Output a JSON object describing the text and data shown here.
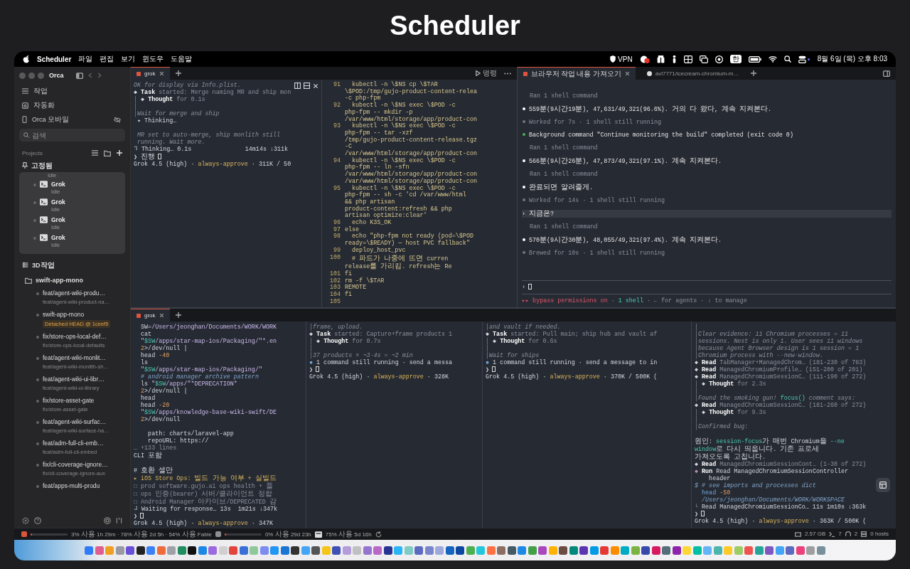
{
  "page_title": "Scheduler",
  "menu_bar": {
    "app_name": "Scheduler",
    "menus": [
      "파일",
      "편집",
      "보기",
      "윈도우",
      "도움말"
    ],
    "vpn_label": "VPN",
    "input_method": "한",
    "clock": "8월 6일 (목) 오후 8:03"
  },
  "sidebar": {
    "app_title": "Orca",
    "nav": [
      {
        "label": "작업",
        "kind": "tasks"
      },
      {
        "label": "자동화",
        "kind": "automation"
      },
      {
        "label": "Orca 모바일",
        "kind": "mobile"
      }
    ],
    "search": {
      "placeholder": "검색"
    },
    "projects_label": "Projects",
    "pinned": {
      "label": "고정됨",
      "clipped_status": "Idle",
      "sessions": [
        {
          "name": "Grok",
          "status": "Idle"
        },
        {
          "name": "Grok",
          "status": "Idle"
        },
        {
          "name": "Grok",
          "status": "Idle"
        },
        {
          "name": "Grok",
          "status": "Idle"
        }
      ]
    },
    "workspace_label": "3D작업",
    "repo": {
      "name": "swift-app-mono",
      "worktrees": [
        {
          "title": "feat/agent-wiki-produ…",
          "subtitle": "feat/agent-wiki-product-na…"
        },
        {
          "title": "swift-app-mono",
          "badge": "Detached HEAD @ 1ceef5"
        },
        {
          "title": "fix/store-ops-local-def…",
          "subtitle": "fix/store-ops-local-defaults"
        },
        {
          "title": "feat/agent-wiki-monlit…",
          "subtitle": "feat/agent-wiki-monlith-sh…"
        },
        {
          "title": "feat/agent-wiki-ui-libr…",
          "subtitle": "feat/agent-wiki-ui-library"
        },
        {
          "title": "fix/store-asset-gate",
          "subtitle": "fix/store-asset-gate"
        },
        {
          "title": "feat/agent-wiki-surfac…",
          "subtitle": "feat/agent-wiki-surface-ha…"
        },
        {
          "title": "feat/adm-full-cli-emb…",
          "subtitle": "feat/adm-full-cli-embed"
        },
        {
          "title": "fix/cli-coverage-ignore…",
          "subtitle": "fix/cli-coverage-ignore-aux"
        },
        {
          "title": "feat/apps-multi-produ"
        }
      ]
    }
  },
  "top_left": {
    "tabs": [
      {
        "label": "grok",
        "selected": true
      }
    ],
    "run_button": "명령",
    "panes": [
      {
        "kind": "chat",
        "header_controls": true,
        "lines": [
          {
            "kind": "italic",
            "text": "OK for display via Info.plist."
          },
          {
            "spans": [
              {
                "kind": "plain",
                "text": "◆ "
              },
              {
                "kind": "bold",
                "text": "Task"
              },
              {
                "kind": "dim",
                "text": " started: Merge naming MR and ship mon"
              }
            ]
          },
          {
            "spans": [
              {
                "kind": "dim",
                "text": "│ "
              },
              {
                "kind": "plain",
                "text": "◆ "
              },
              {
                "kind": "bold",
                "text": "Thought"
              },
              {
                "kind": "dim",
                "text": " for 0.1s"
              }
            ]
          },
          {
            "kind": "dim",
            "text": "│"
          },
          {
            "kind": "italic",
            "text": "│Wait for merge and ship"
          },
          {
            "kind": "plain",
            "text": " ✦ Thinking…"
          },
          {
            "kind": "blank"
          },
          {
            "kind": "italic",
            "text": " MR set to auto-merge, ship monlith still"
          },
          {
            "kind": "italic",
            "text": " running. Wait more."
          },
          {
            "kind": "plain",
            "text": "⠹ Thinking… 0.1s               14m14s ↓311k"
          },
          {
            "kind": "prompt",
            "text": "❯ 진행"
          },
          {
            "spans": [
              {
                "kind": "plain",
                "text": "Grok 4.5 (high) · "
              },
              {
                "kind": "yellow",
                "text": "always-approve"
              },
              {
                "kind": "plain",
                "text": " · 311K / 50"
              }
            ]
          }
        ]
      },
      {
        "kind": "code",
        "lines": [
          {
            "number": "91",
            "text": "  kubectl -n \\$NS cp \\$TAR"
          },
          {
            "text": "\\$POD:/tmp/gujo-product-content-relea"
          },
          {
            "text": "-c php-fpm"
          },
          {
            "number": "92",
            "text": "  kubectl -n \\$NS exec \\$POD -c"
          },
          {
            "text": "php-fpm -- mkdir -p"
          },
          {
            "text": "/var/www/html/storage/app/product-con"
          },
          {
            "number": "93",
            "text": "  kubectl -n \\$NS exec \\$POD -c"
          },
          {
            "text": "php-fpm -- tar -xzf"
          },
          {
            "text": "/tmp/gujo-product-content-release.tgz"
          },
          {
            "text": "-C"
          },
          {
            "text": "/var/www/html/storage/app/product-con"
          },
          {
            "number": "94",
            "text": "  kubectl -n \\$NS exec \\$POD -c"
          },
          {
            "text": "php-fpm -- ln -sfn"
          },
          {
            "text": "/var/www/html/storage/app/product-con"
          },
          {
            "text": "/var/www/html/storage/app/product-con"
          },
          {
            "number": "95",
            "text": "  kubectl -n \\$NS exec \\$POD -c"
          },
          {
            "text": "php-fpm -- sh -c 'cd /var/www/html"
          },
          {
            "text": "&& php artisan"
          },
          {
            "text": "product-content:refresh && php"
          },
          {
            "text": "artisan optimize:clear'"
          },
          {
            "number": "96",
            "text": "  echo K3S_OK"
          },
          {
            "number": "97",
            "text": "else"
          },
          {
            "number": "98",
            "text": "  echo \"php-fpm not ready (pod=\\$POD"
          },
          {
            "text": "ready=\\$READY) — host PVC fallback\""
          },
          {
            "number": "99",
            "text": "  deploy_host_pvc"
          },
          {
            "number": "100",
            "text": "  # 파드가 나중에 뜨면 curren"
          },
          {
            "text": "release를 가리킴. refresh는 Re"
          },
          {
            "number": "101",
            "text": "fi"
          },
          {
            "number": "102",
            "text": "rm -f \\$TAR"
          },
          {
            "number": "103",
            "text": "REMOTE"
          },
          {
            "number": "104",
            "text": "fi"
          },
          {
            "number": "105"
          }
        ]
      }
    ]
  },
  "top_right": {
    "tabs": [
      {
        "label": "브라우저 작업 내용 가져오기",
        "kind": "terminal",
        "selected": true
      },
      {
        "label": "avl7771/icecream-chromium-m…",
        "kind": "web",
        "selected": false
      }
    ],
    "lines": [
      {
        "kind": "tool",
        "text": "Ran 1 shell command"
      },
      {
        "kind": "message",
        "text": "559분(9시간19분), 47,631/49,321(96.6%). 거의 다 왔다, 계속 지켜본다."
      },
      {
        "kind": "status",
        "text": "Worked for 7s · 1 shell still running"
      },
      {
        "kind": "event",
        "text": "Background command \"Continue monitoring the build\" completed (exit code 0)"
      },
      {
        "kind": "tool",
        "text": "Ran 1 shell command"
      },
      {
        "kind": "message",
        "text": "566분(9시간26분), 47,873/49,321(97.1%). 계속 지켜본다."
      },
      {
        "kind": "tool",
        "text": "Ran 1 shell command"
      },
      {
        "kind": "message",
        "text": "완료되면 알려줄게."
      },
      {
        "kind": "status",
        "text": "Worked for 14s · 1 shell still running"
      },
      {
        "kind": "input",
        "text": "› 지금은?"
      },
      {
        "kind": "tool",
        "text": "Ran 1 shell command"
      },
      {
        "kind": "message",
        "text": "570분(9시간30분), 48,055/49,321(97.4%). 계속 지켜본다."
      },
      {
        "kind": "status",
        "text": "Brewed for 10s · 1 shell still running"
      }
    ],
    "footer": [
      {
        "kind": "divider"
      },
      {
        "kind": "prompt",
        "text": "›"
      },
      {
        "kind": "divider"
      },
      {
        "spans": [
          {
            "kind": "red",
            "text": "▸▸ bypass permissions on"
          },
          {
            "kind": "dim",
            "text": " · "
          },
          {
            "kind": "cyan",
            "text": "1 shell"
          },
          {
            "kind": "dim",
            "text": " · ← for agents · ↓ to manage"
          }
        ]
      }
    ]
  },
  "bottom": {
    "tabs": [
      {
        "label": "grok",
        "selected": true
      }
    ],
    "panes": [
      {
        "kind": "chat",
        "lines": [
          {
            "spans": [
              {
                "kind": "plain",
                "text": "  SW="
              },
              {
                "kind": "lav",
                "text": "/Users/jeonghan/Documents/WORK/WORK"
              }
            ]
          },
          {
            "kind": "plain",
            "text": "  cat"
          },
          {
            "spans": [
              {
                "kind": "lav",
                "text": "  \""
              },
              {
                "kind": "cyan",
                "text": "$SW"
              },
              {
                "kind": "lav",
                "text": "/apps/star-map-ios/Packaging/\"*.en"
              }
            ]
          },
          {
            "spans": [
              {
                "kind": "orange",
                "text": "  2"
              },
              {
                "kind": "plain",
                "text": ">/dev/null |"
              }
            ]
          },
          {
            "spans": [
              {
                "kind": "plain",
                "text": "  head "
              },
              {
                "kind": "orange",
                "text": "-40"
              }
            ]
          },
          {
            "kind": "plain",
            "text": "  ls"
          },
          {
            "spans": [
              {
                "kind": "lav",
                "text": "  \""
              },
              {
                "kind": "cyan",
                "text": "$SW"
              },
              {
                "kind": "lav",
                "text": "/apps/star-map-ios/Packaging/\""
              }
            ]
          },
          {
            "kind": "comment",
            "text": "  # android manager archive pattern"
          },
          {
            "spans": [
              {
                "kind": "plain",
                "text": "  ls "
              },
              {
                "kind": "lav",
                "text": "\""
              },
              {
                "kind": "cyan",
                "text": "$SW"
              },
              {
                "kind": "lav",
                "text": "/apps/\"*DEPRECATION*"
              }
            ]
          },
          {
            "spans": [
              {
                "kind": "orange",
                "text": "  2"
              },
              {
                "kind": "plain",
                "text": ">/dev/null |"
              }
            ]
          },
          {
            "kind": "plain",
            "text": "  head"
          },
          {
            "spans": [
              {
                "kind": "plain",
                "text": "  head "
              },
              {
                "kind": "orange",
                "text": "-20"
              }
            ]
          },
          {
            "spans": [
              {
                "kind": "lav",
                "text": "  \""
              },
              {
                "kind": "cyan",
                "text": "$SW"
              },
              {
                "kind": "lav",
                "text": "/apps/knowledge-base-wiki-swift/DE"
              }
            ]
          },
          {
            "spans": [
              {
                "kind": "orange",
                "text": "  2"
              },
              {
                "kind": "plain",
                "text": ">/dev/null"
              }
            ]
          },
          {
            "kind": "blank"
          },
          {
            "kind": "plain",
            "text": "    path: charts/laravel-app"
          },
          {
            "kind": "plain",
            "text": "    repoURL: https://"
          },
          {
            "kind": "dim",
            "text": "… +133 lines"
          },
          {
            "kind": "plain",
            "text": "CLI 포함"
          },
          {
            "kind": "blank"
          },
          {
            "kind": "plain",
            "text": "# 호환 셀만"
          },
          {
            "kind": "yellow",
            "text": "▸ iOS Store Ops: 빌드 가능 여부 + 실빌드"
          },
          {
            "kind": "dim",
            "text": "□ prod software.gujo.ai ops health + 플"
          },
          {
            "kind": "dim",
            "text": "□ ops 인증(bearer) 서버/클라이언트 정합"
          },
          {
            "kind": "dim",
            "text": "□ Android Manager 아카이브/DEPRECATED 감"
          },
          {
            "kind": "plain",
            "text": "⠼ Waiting for response… 13s  1m21s ↓347k"
          },
          {
            "kind": "prompt",
            "text": "❯"
          },
          {
            "spans": [
              {
                "kind": "plain",
                "text": "Grok 4.5 (high) · "
              },
              {
                "kind": "yellow",
                "text": "always-approve"
              },
              {
                "kind": "plain",
                "text": " · 347K"
              }
            ]
          }
        ]
      },
      {
        "kind": "chat",
        "lines": [
          {
            "kind": "italic",
            "text": "│frame, upload."
          },
          {
            "spans": [
              {
                "kind": "plain",
                "text": "◆ "
              },
              {
                "kind": "bold",
                "text": "Task"
              },
              {
                "kind": "dim",
                "text": " started: Capture+frame products 1"
              }
            ]
          },
          {
            "spans": [
              {
                "kind": "dim",
                "text": "│ "
              },
              {
                "kind": "plain",
                "text": "◆ "
              },
              {
                "kind": "bold",
                "text": "Thought"
              },
              {
                "kind": "dim",
                "text": " for 0.7s"
              }
            ]
          },
          {
            "kind": "dim",
            "text": "│"
          },
          {
            "kind": "italic",
            "text": "│37 products × ~3-4s = ~2 min"
          },
          {
            "spans": [
              {
                "kind": "blue",
                "text": "● "
              },
              {
                "kind": "plain",
                "text": "1 command still running · send a messa"
              }
            ]
          },
          {
            "kind": "prompt",
            "text": "❯"
          },
          {
            "spans": [
              {
                "kind": "plain",
                "text": "Grok 4.5 (high) · "
              },
              {
                "kind": "yellow",
                "text": "always-approve"
              },
              {
                "kind": "plain",
                "text": " · 328K"
              }
            ]
          }
        ]
      },
      {
        "kind": "chat",
        "lines": [
          {
            "kind": "italic",
            "text": "│and vault if needed."
          },
          {
            "spans": [
              {
                "kind": "plain",
                "text": "◆ "
              },
              {
                "kind": "bold",
                "text": "Task"
              },
              {
                "kind": "dim",
                "text": " started: Pull main; ship hub and vault af"
              }
            ]
          },
          {
            "spans": [
              {
                "kind": "dim",
                "text": "│ "
              },
              {
                "kind": "plain",
                "text": "◆ "
              },
              {
                "kind": "bold",
                "text": "Thought"
              },
              {
                "kind": "dim",
                "text": " for 0.6s"
              }
            ]
          },
          {
            "kind": "dim",
            "text": "│"
          },
          {
            "kind": "italic",
            "text": "│Wait for ships"
          },
          {
            "spans": [
              {
                "kind": "blue",
                "text": "● "
              },
              {
                "kind": "plain",
                "text": "1 command still running · send a message to in"
              }
            ]
          },
          {
            "kind": "prompt",
            "text": "❯"
          },
          {
            "spans": [
              {
                "kind": "plain",
                "text": "Grok 4.5 (high) · "
              },
              {
                "kind": "yellow",
                "text": "always-approve"
              },
              {
                "kind": "plain",
                "text": " · 370K / 500K ("
              }
            ]
          }
        ]
      },
      {
        "kind": "chat",
        "layout_button": true,
        "lines": [
          {
            "kind": "dim",
            "text": "│"
          },
          {
            "kind": "italic",
            "text": "│Clear evidence: 11 Chromium processes = 11"
          },
          {
            "kind": "italic",
            "text": "│sessions. Nest is only 1. User sees 11 windows"
          },
          {
            "kind": "italic",
            "text": "│because Agent Browser design is 1 session = 1"
          },
          {
            "kind": "italic",
            "text": "│Chromium process with --new-window."
          },
          {
            "spans": [
              {
                "kind": "plain",
                "text": "◆ "
              },
              {
                "kind": "bold",
                "text": "Read"
              },
              {
                "kind": "dim",
                "text": " TabManager+ManagedChrom… (181-230 of 783)"
              }
            ]
          },
          {
            "spans": [
              {
                "kind": "plain",
                "text": "◆ "
              },
              {
                "kind": "bold",
                "text": "Read"
              },
              {
                "kind": "dim",
                "text": " ManagedChromiumProfile… (151-200 of 201)"
              }
            ]
          },
          {
            "spans": [
              {
                "kind": "plain",
                "text": "◆ "
              },
              {
                "kind": "bold",
                "text": "Read"
              },
              {
                "kind": "dim",
                "text": " ManagedChromiumSessionC… (111-190 of 272)"
              }
            ]
          },
          {
            "spans": [
              {
                "kind": "dim",
                "text": "│ "
              },
              {
                "kind": "plain",
                "text": "◆ "
              },
              {
                "kind": "bold",
                "text": "Thought"
              },
              {
                "kind": "dim",
                "text": " for 2.3s"
              }
            ]
          },
          {
            "kind": "dim",
            "text": "│"
          },
          {
            "spans": [
              {
                "kind": "italic",
                "text": "│Found the smoking gun! "
              },
              {
                "kind": "cyan",
                "text": "focus()"
              },
              {
                "kind": "italic",
                "text": " comment says:"
              }
            ]
          },
          {
            "spans": [
              {
                "kind": "plain",
                "text": "◆ "
              },
              {
                "kind": "bold",
                "text": "Read"
              },
              {
                "kind": "dim",
                "text": " ManagedChromiumSessionC… (181-260 of 272)"
              }
            ]
          },
          {
            "spans": [
              {
                "kind": "dim",
                "text": "│ "
              },
              {
                "kind": "plain",
                "text": "◆ "
              },
              {
                "kind": "bold",
                "text": "Thought"
              },
              {
                "kind": "dim",
                "text": " for 9.3s"
              }
            ]
          },
          {
            "kind": "dim",
            "text": "│"
          },
          {
            "kind": "italic",
            "text": "│Confirmed bug:"
          },
          {
            "kind": "blank"
          },
          {
            "spans": [
              {
                "kind": "plain",
                "text": "원인: "
              },
              {
                "kind": "cyan",
                "text": "session-focus"
              },
              {
                "kind": "plain",
                "text": "가 매번 Chromium을 "
              },
              {
                "kind": "cyan",
                "text": "--ne"
              }
            ]
          },
          {
            "spans": [
              {
                "kind": "cyan",
                "text": "window"
              },
              {
                "kind": "plain",
                "text": "로 다시 띄웁니다. 기존 프로세"
              }
            ]
          },
          {
            "kind": "plain",
            "text": "가져오도록 고칩니다."
          },
          {
            "spans": [
              {
                "kind": "plain",
                "text": "◆ "
              },
              {
                "kind": "bold",
                "text": "Read"
              },
              {
                "kind": "dim",
                "text": " ManagedChromiumSessionCont… (1-30 of 272)"
              }
            ]
          },
          {
            "spans": [
              {
                "kind": "purple",
                "text": "◆ "
              },
              {
                "kind": "bold",
                "text": "Run"
              },
              {
                "kind": "plain",
                "text": " Read ManagedChromiumSessionController"
              }
            ]
          },
          {
            "kind": "plain",
            "text": "    header"
          },
          {
            "kind": "comment",
            "text": "$ # see imports and processes dict"
          },
          {
            "spans": [
              {
                "kind": "blue",
                "text": "  head "
              },
              {
                "kind": "orange",
                "text": "-50"
              }
            ]
          },
          {
            "kind": "comment",
            "text": "  /Users/jeonghan/Documents/WORK/WORKSPACE"
          },
          {
            "spans": [
              {
                "kind": "dim",
                "text": "└ "
              },
              {
                "kind": "plain",
                "text": "Read ManagedChromiumSessionCo… 11s 1m10s ↓363k"
              }
            ]
          },
          {
            "kind": "prompt",
            "text": "❯"
          },
          {
            "spans": [
              {
                "kind": "plain",
                "text": "Grok 4.5 (high) · "
              },
              {
                "kind": "yellow",
                "text": "always-approve"
              },
              {
                "kind": "plain",
                "text": " · 363K / 500K ("
              }
            ]
          }
        ]
      }
    ]
  },
  "status_bar": {
    "segments": [
      {
        "kind": "meter",
        "color": "#d9553c",
        "level": 0.03,
        "text": "3% 사용 1h 29m · 78% 사용 2d 5h · 54% 사용 Fable"
      },
      {
        "kind": "meter",
        "color": "#8e8e93",
        "level": 0,
        "text": "0% 사용 29d 23h"
      },
      {
        "kind": "badge",
        "text": "75% 사용 5d 16h"
      }
    ],
    "right": [
      {
        "kind": "memory",
        "text": "2.57 GB"
      },
      {
        "kind": "terminal",
        "text": "7"
      },
      {
        "kind": "agents",
        "text": "2"
      },
      {
        "kind": "hosts",
        "text": "0 hosts"
      }
    ]
  }
}
